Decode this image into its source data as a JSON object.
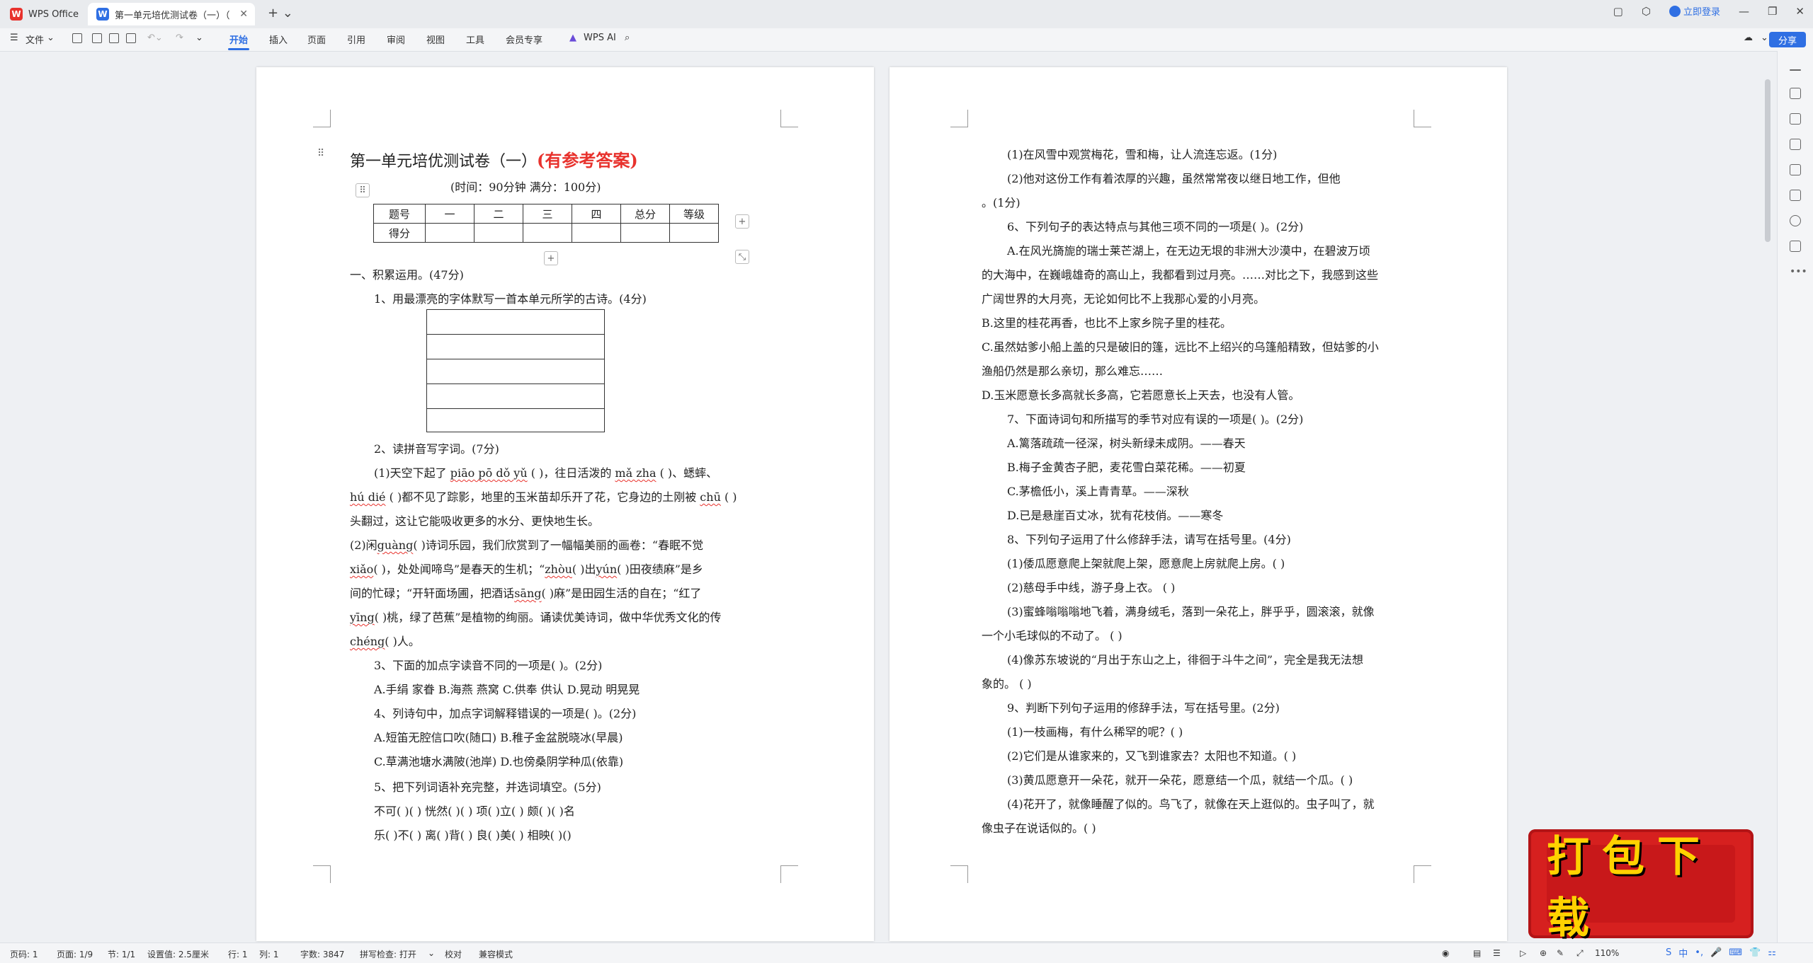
{
  "tabs": {
    "wps_label": "WPS Office",
    "doc_label": "第一单元培优测试卷（一）（"
  },
  "titlebar": {
    "login_label": "立即登录"
  },
  "toolbar": {
    "file": "文件",
    "items": [
      "开始",
      "插入",
      "页面",
      "引用",
      "审阅",
      "视图",
      "工具",
      "会员专享"
    ],
    "ai": "WPS AI",
    "share": "分享"
  },
  "left_page": {
    "title_main": "第一单元培优测试卷（一）",
    "title_red": "(有参考答案)",
    "meta": "(时间：90分钟    满分：100分)",
    "score_header": [
      "题号",
      "一",
      "二",
      "三",
      "四",
      "总分",
      "等级"
    ],
    "score_row": [
      "得分",
      "",
      "",
      "",
      "",
      "",
      ""
    ],
    "lines": [
      "一、积累运用。(47分)",
      "1、用最漂亮的字体默写一首本单元所学的古诗。(4分)",
      "2、读拼音写字词。(7分)"
    ],
    "q2_1a": "(1)天空下起了",
    "q2_1b": "piāo  pō  dǒ  yǔ",
    "q2_1c": "(  )，往日活泼的",
    "q2_1d": "mǎ  zha",
    "q2_1e": "(  )、蟋蟀、",
    "q2_2a": "hú  dié",
    "q2_2b": "(  )都不见了踪影，地里的玉米苗却乐开了花，它身边的土刚被",
    "q2_2c": "chū",
    "q2_2d": "(  )",
    "q2_3": "头翻过，这让它能吸收更多的水分、更快地生长。",
    "q2_4a": "(2)闲",
    "q2_4b": "guàng",
    "q2_4c": "(  )诗词乐园，我们欣赏到了一幅幅美丽的画卷：“春眠不觉",
    "q2_5a": "xiǎo",
    "q2_5b": "(  )，处处闻啼鸟”是春天的生机；“",
    "q2_5c": "zhòu",
    "q2_5d": "(  )出",
    "q2_5e": "yún",
    "q2_5f": "(  )田夜绩麻”是乡",
    "q2_6a": "间的忙碌；“开轩面场圃，把酒话",
    "q2_6b": "sāng",
    "q2_6c": "(  )麻”是田园生活的自在；“红了",
    "q2_7a": "yīng",
    "q2_7b": "(  )桃，绿了芭蕉”是植物的绚丽。诵读优美诗词，做中华优秀文化的传",
    "q2_8a": "chéng",
    "q2_8b": "(  )人。",
    "rest": [
      "3、下面的加点字读音不同的一项是(  )。(2分)",
      "A.手绢    家眷   B.海燕    燕窝   C.供奉    供认   D.晃动    明晃晃",
      "4、列诗句中，加点字词解释错误的一项是(  )。(2分)",
      "A.短笛无腔信口吹(随口)     B.稚子金盆脱晓冰(早晨)",
      "C.草满池塘水满陂(池岸)     D.也傍桑阴学种瓜(依靠)",
      "5、把下列词语补充完整，并选词填空。(5分)",
      "不可(  )(  )    恍然(  )(  )    项(  )立(  )    颇(  )(  )名",
      "乐(  )不(  )    离(  )背(  )    良(  )美(  )    相映(  )()"
    ]
  },
  "right_page": {
    "lines": [
      "(1)在风雪中观赏梅花，雪和梅，让人流连忘返。(1分)",
      "(2)他对这份工作有着浓厚的兴趣，虽然常常夜以继日地工作，但他",
      "。(1分)",
      "6、下列句子的表达特点与其他三项不同的一项是(  )。(2分)",
      "A.在风光旖旎的瑞士莱芒湖上，在无边无垠的非洲大沙漠中，在碧波万顷",
      "的大海中，在巍峨雄奇的高山上，我都看到过月亮。……对比之下，我感到这些",
      "广阔世界的大月亮，无论如何比不上我那心爱的小月亮。",
      "B.这里的桂花再香，也比不上家乡院子里的桂花。",
      "C.虽然姑爹小船上盖的只是破旧的篷，远比不上绍兴的乌篷船精致，但姑爹的小",
      "渔船仍然是那么亲切，那么难忘……",
      "D.玉米愿意长多高就长多高，它若愿意长上天去，也没有人管。",
      "7、下面诗词句和所描写的季节对应有误的一项是(  )。(2分)",
      "A.篱落疏疏一径深，树头新绿未成阴。——春天",
      "B.梅子金黄杏子肥，麦花雪白菜花稀。——初夏",
      "C.茅檐低小，溪上青青草。——深秋",
      "D.已是悬崖百丈冰，犹有花枝俏。——寒冬",
      "8、下列句子运用了什么修辞手法，请写在括号里。(4分)",
      "(1)倭瓜愿意爬上架就爬上架，愿意爬上房就爬上房。(      )",
      "(2)慈母手中线，游子身上衣。    (      )",
      "(3)蜜蜂嗡嗡嗡地飞着，满身绒毛，落到一朵花上，胖乎乎，圆滚滚，就像",
      "一个小毛球似的不动了。    (      )",
      "(4)像苏东坡说的“月出于东山之上，徘徊于斗牛之间”，完全是我无法想",
      "象的。    (      )",
      "9、判断下列句子运用的修辞手法，写在括号里。(2分)",
      "(1)一枝画梅，有什么稀罕的呢？(  )",
      "(2)它们是从谁家来的，又飞到谁家去？太阳也不知道。(  )",
      "(3)黄瓜愿意开一朵花，就开一朵花，愿意结一个瓜，就结一个瓜。(  )",
      "(4)花开了，就像睡醒了似的。鸟飞了，就像在天上逛似的。虫子叫了，就",
      "像虫子在说话似的。(  )"
    ]
  },
  "status": {
    "page_num": "页码: 1",
    "page_of": "页面: 1/9",
    "section": "节: 1/1",
    "setting": "设置值: 2.5厘米",
    "row": "行: 1",
    "col": "列: 1",
    "words": "字数: 3847",
    "spell": "拼写检查: 打开",
    "proof": "校对",
    "compat": "兼容模式",
    "zoom": "110%"
  },
  "stamp": {
    "text": "打包下载"
  },
  "tray": {
    "items": [
      "S",
      "中",
      "•,",
      "🎤",
      "⌨",
      "👕",
      "⚏"
    ]
  }
}
